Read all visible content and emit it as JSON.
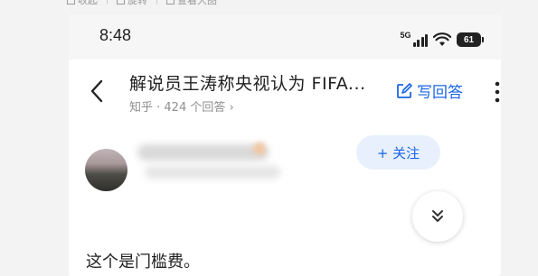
{
  "host_toolbar": {
    "items": [
      {
        "label": "收起",
        "icon": "collapse-icon"
      },
      {
        "label": "旋转",
        "icon": "rotate-icon"
      },
      {
        "label": "查看大图",
        "icon": "zoom-icon"
      }
    ]
  },
  "status_bar": {
    "time": "8:48",
    "network": "5G",
    "battery": "61"
  },
  "header": {
    "title": "解说员王涛称央视认为 FIFA...",
    "meta": "知乎 · 424 个回答 ›",
    "write_answer_label": "写回答",
    "back_icon": "chevron-left-icon",
    "more_icon": "more-vertical-icon",
    "write_icon": "edit-icon"
  },
  "author": {
    "follow_label": "+ 关注"
  },
  "answer": {
    "text": "这个是门槛费。",
    "expand_icon": "double-chevron-down-icon"
  },
  "colors": {
    "accent": "#1a66e6",
    "follow_bg": "#e8f0fd"
  }
}
